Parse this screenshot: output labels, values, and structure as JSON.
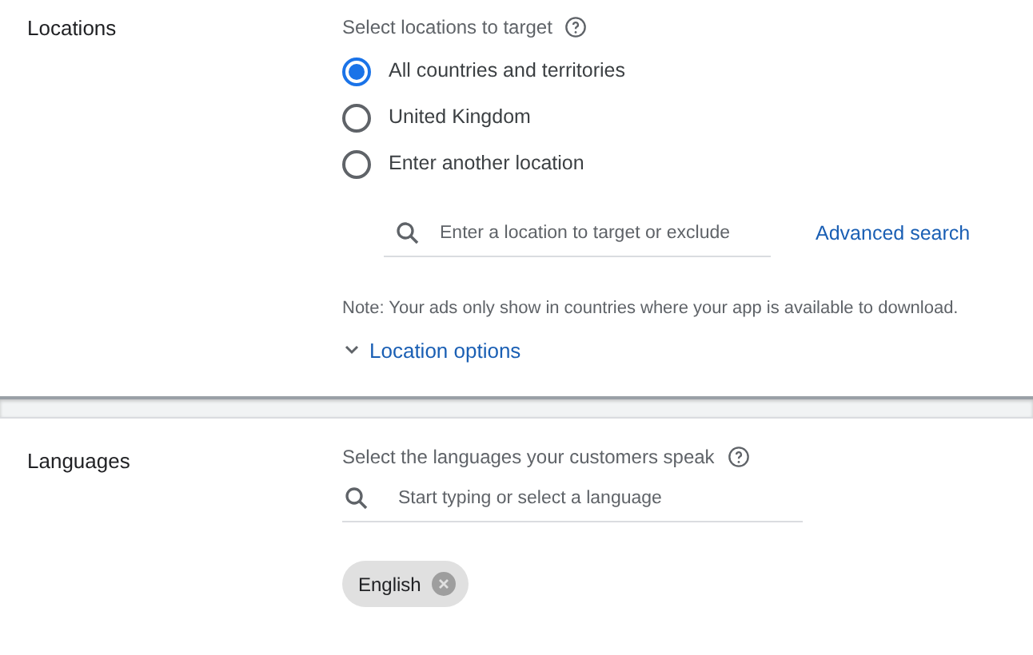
{
  "locations": {
    "label": "Locations",
    "title": "Select locations to target",
    "options": [
      {
        "label": "All countries and territories",
        "selected": true
      },
      {
        "label": "United Kingdom",
        "selected": false
      },
      {
        "label": "Enter another location",
        "selected": false
      }
    ],
    "search": {
      "placeholder": "Enter a location to target or exclude"
    },
    "advanced_link": "Advanced search",
    "note": "Note: Your ads only show in countries where your app is available to download.",
    "options_toggle": {
      "label": "Location options",
      "expanded": false
    }
  },
  "languages": {
    "label": "Languages",
    "title": "Select the languages your customers speak",
    "search": {
      "placeholder": "Start typing or select a language"
    },
    "chips": [
      "English"
    ]
  }
}
